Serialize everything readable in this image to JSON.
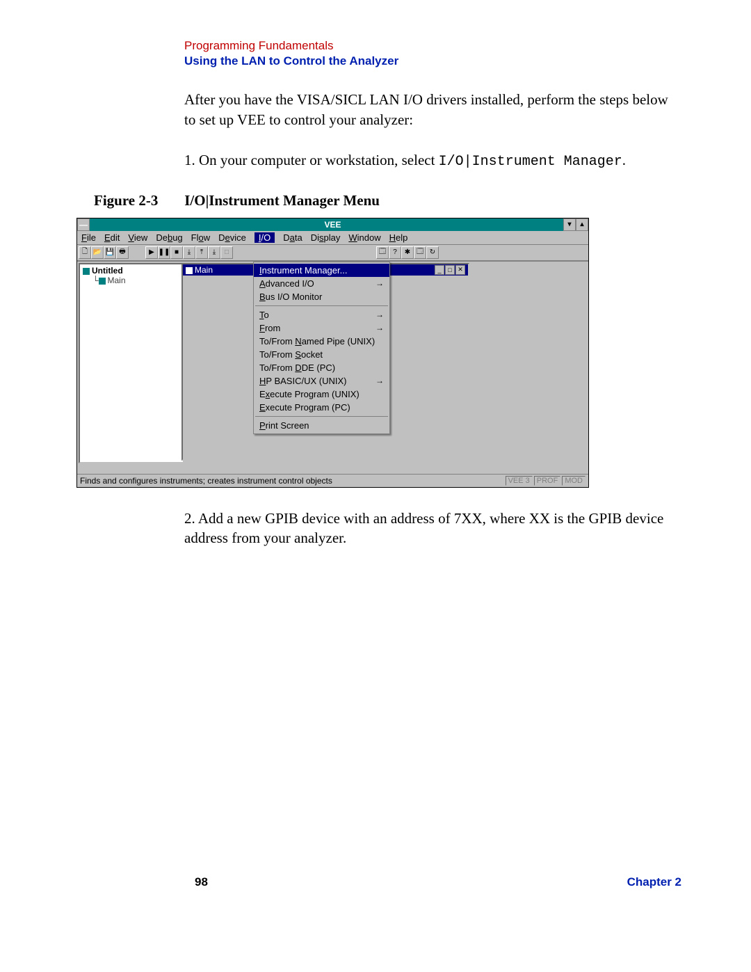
{
  "header": {
    "line1": "Programming Fundamentals",
    "line2": "Using the LAN to Control the Analyzer"
  },
  "intro_para": "After you have the VISA/SICL LAN I/O drivers installed, perform the steps below to set up VEE to control your analyzer:",
  "step1_prefix": "1.  On your computer or workstation, select ",
  "step1_mono": "I/O|Instrument Manager",
  "step1_suffix": ".",
  "figure": {
    "label": "Figure 2-3",
    "title": "I/O|Instrument Manager Menu"
  },
  "vee": {
    "title": "VEE",
    "menubar": [
      "File",
      "Edit",
      "View",
      "Debug",
      "Flow",
      "Device",
      "I/O",
      "Data",
      "Display",
      "Window",
      "Help"
    ],
    "active_menu_index": 6,
    "tree": {
      "root": "Untitled",
      "child": "Main"
    },
    "main_panel_title": "Main",
    "dropdown": {
      "items": [
        {
          "label": "Instrument Manager...",
          "selected": true
        },
        {
          "label": "Advanced I/O",
          "submenu": true
        },
        {
          "label": "Bus I/O Monitor"
        },
        {
          "sep": true
        },
        {
          "label": "To",
          "submenu": true
        },
        {
          "label": "From",
          "submenu": true
        },
        {
          "label": "To/From Named Pipe (UNIX)"
        },
        {
          "label": "To/From Socket"
        },
        {
          "label": "To/From DDE (PC)"
        },
        {
          "label": "HP BASIC/UX (UNIX)",
          "submenu": true
        },
        {
          "label": "Execute Program (UNIX)"
        },
        {
          "label": "Execute Program (PC)"
        },
        {
          "sep": true
        },
        {
          "label": "Print Screen"
        }
      ]
    },
    "status_text": "Finds and configures instruments; creates instrument control objects",
    "status_indicators": [
      "VEE 3",
      "PROF",
      "MOD"
    ]
  },
  "step2": "2.  Add a new GPIB device with an address of 7XX, where XX is the GPIB device address from your analyzer.",
  "footer": {
    "page_number": "98",
    "chapter": "Chapter 2"
  }
}
